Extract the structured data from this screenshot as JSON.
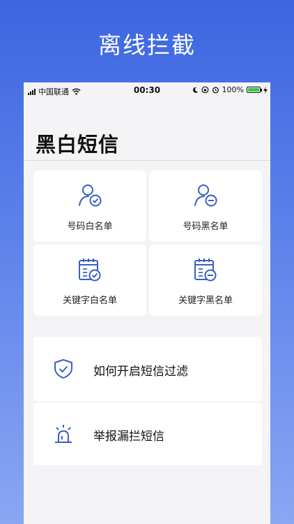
{
  "headline": "离线拦截",
  "status_bar": {
    "carrier": "中国联通",
    "time": "00:30",
    "battery": "100%"
  },
  "page": {
    "title": "黑白短信"
  },
  "grid_items": [
    {
      "label": "号码白名单",
      "icon": "user-check-icon"
    },
    {
      "label": "号码黑名单",
      "icon": "user-minus-icon"
    },
    {
      "label": "关键字白名单",
      "icon": "calendar-check-icon"
    },
    {
      "label": "关键字黑名单",
      "icon": "calendar-minus-icon"
    }
  ],
  "list_items": [
    {
      "label": "如何开启短信过滤",
      "icon": "shield-check-icon"
    },
    {
      "label": "举报漏拦短信",
      "icon": "alarm-siren-icon"
    }
  ],
  "colors": {
    "accent": "#3b5fc0",
    "background_top": "#3d66e0",
    "background_bottom": "#8aa6f3"
  }
}
